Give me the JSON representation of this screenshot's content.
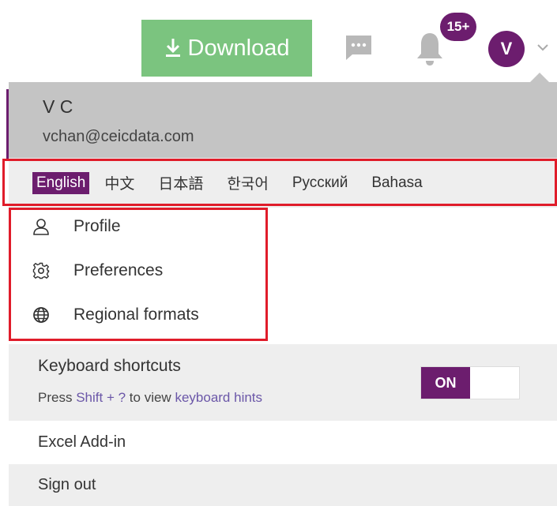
{
  "topbar": {
    "download_label": "Download",
    "notifications_count": "15+",
    "avatar_initial": "V",
    "icons": [
      "download-icon",
      "chat-icon",
      "bell-icon",
      "chevron-down-icon"
    ]
  },
  "user": {
    "name": "V C",
    "email": "vchan@ceicdata.com"
  },
  "languages": [
    "English",
    "中文",
    "日本語",
    "한국어",
    "Русский",
    "Bahasa"
  ],
  "active_language": "English",
  "menu": {
    "profile": "Profile",
    "preferences": "Preferences",
    "regional_formats": "Regional formats"
  },
  "keyboard": {
    "title": "Keyboard shortcuts",
    "hint_prefix": "Press",
    "hint_key": "Shift + ?",
    "hint_mid": "to view",
    "hint_link": "keyboard hints",
    "toggle": "ON"
  },
  "excel_addin": "Excel Add-in",
  "sign_out": "Sign out",
  "colors": {
    "accent": "#6c1d6e",
    "download": "#7bc47f",
    "highlight_outline": "#e01c2a",
    "link": "#6b57a8"
  }
}
